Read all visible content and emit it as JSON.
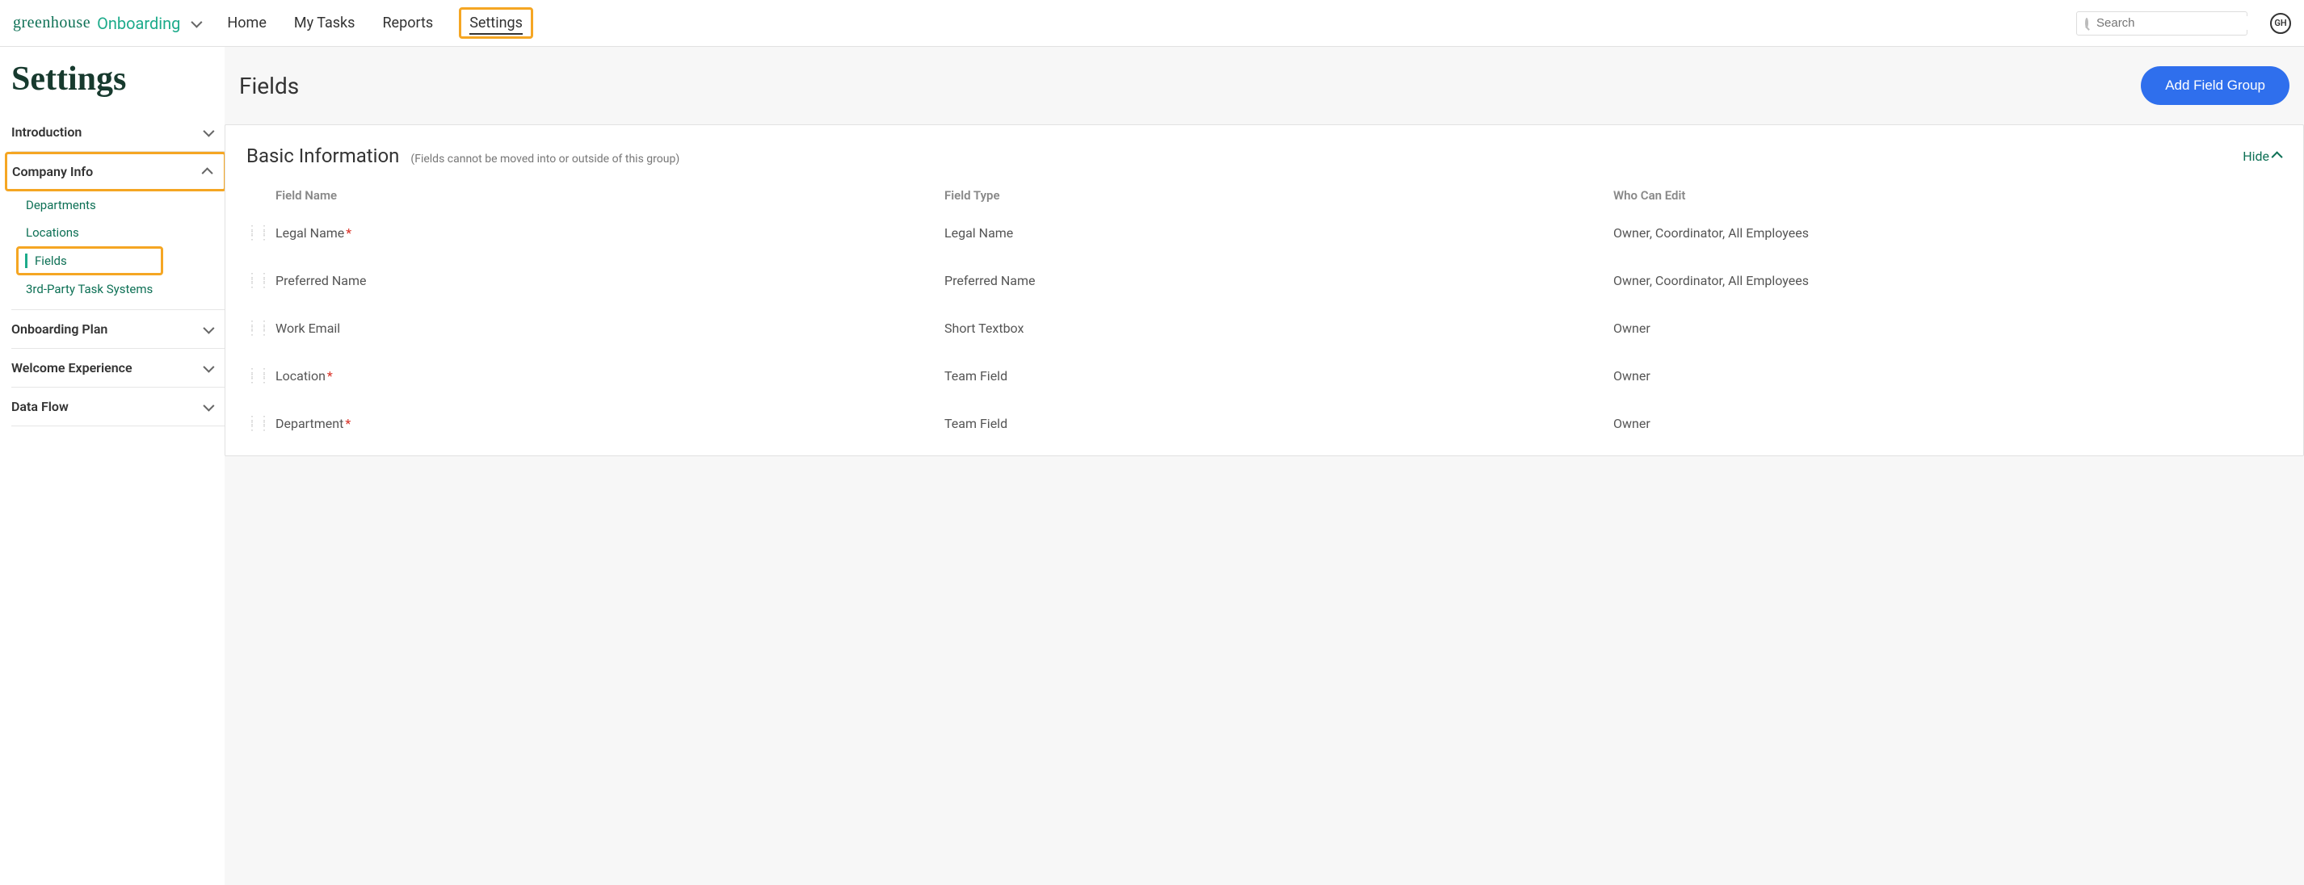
{
  "logo": {
    "brand": "greenhouse",
    "product": "Onboarding"
  },
  "nav": {
    "items": [
      {
        "label": "Home"
      },
      {
        "label": "My Tasks"
      },
      {
        "label": "Reports"
      },
      {
        "label": "Settings",
        "active": true
      }
    ]
  },
  "search": {
    "placeholder": "Search"
  },
  "avatar": {
    "initials": "GH"
  },
  "page": {
    "title": "Settings"
  },
  "sidebar": {
    "sections": [
      {
        "label": "Introduction",
        "expanded": false
      },
      {
        "label": "Company Info",
        "expanded": true,
        "items": [
          {
            "label": "Departments"
          },
          {
            "label": "Locations"
          },
          {
            "label": "Fields",
            "active": true
          },
          {
            "label": "3rd-Party Task Systems"
          }
        ]
      },
      {
        "label": "Onboarding Plan",
        "expanded": false
      },
      {
        "label": "Welcome Experience",
        "expanded": false
      },
      {
        "label": "Data Flow",
        "expanded": false
      }
    ]
  },
  "fields": {
    "title": "Fields",
    "add_button": "Add Field Group",
    "group": {
      "title": "Basic Information",
      "note": "(Fields cannot be moved into or outside of this group)",
      "toggle_label": "Hide",
      "columns": {
        "name": "Field Name",
        "type": "Field Type",
        "who": "Who Can Edit"
      },
      "rows": [
        {
          "name": "Legal Name",
          "required": true,
          "type": "Legal Name",
          "who": "Owner, Coordinator, All Employees"
        },
        {
          "name": "Preferred Name",
          "required": false,
          "type": "Preferred Name",
          "who": "Owner, Coordinator, All Employees"
        },
        {
          "name": "Work Email",
          "required": false,
          "type": "Short Textbox",
          "who": "Owner"
        },
        {
          "name": "Location",
          "required": true,
          "type": "Team Field",
          "who": "Owner"
        },
        {
          "name": "Department",
          "required": true,
          "type": "Team Field",
          "who": "Owner"
        }
      ]
    }
  }
}
